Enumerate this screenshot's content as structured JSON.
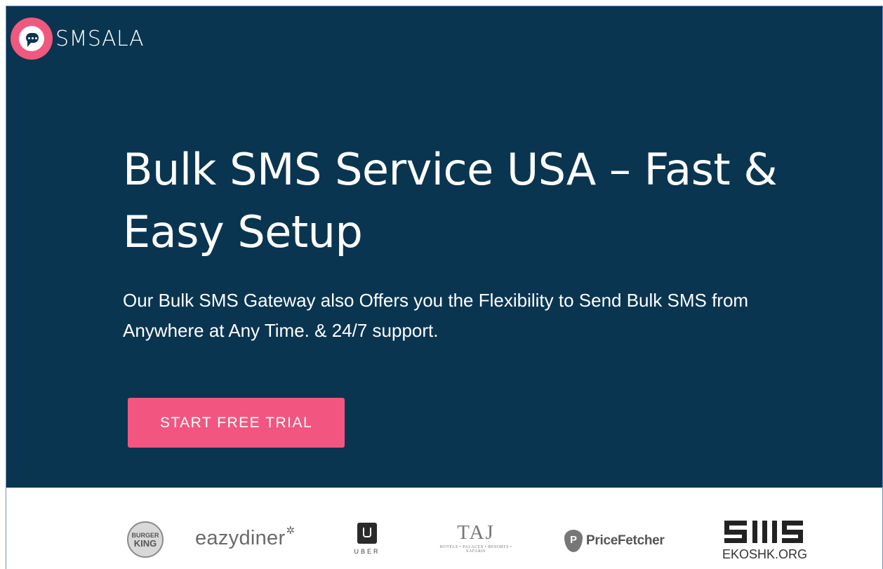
{
  "brand": {
    "name": "SMSALA",
    "logo_icon": "chat-bubble-icon",
    "accent": "#f25680"
  },
  "hero": {
    "background": "#0a3551",
    "headline": "Bulk SMS Service USA – Fast & Easy Setup",
    "subtitle": "Our Bulk SMS Gateway also Offers you the Flexibility to Send Bulk SMS from Anywhere at Any Time. & 24/7 support.",
    "cta_label": "START FREE TRIAL"
  },
  "clients": {
    "burger_king": {
      "line1": "BURGER",
      "line2": "KING"
    },
    "eazydiner": {
      "name": "eazydiner"
    },
    "uber": {
      "name": "UBER"
    },
    "taj": {
      "name": "TAJ",
      "tagline": "HOTELS • PALACES • RESORTS • SAFARIS"
    },
    "pricefetcher": {
      "name": "PriceFetcher"
    },
    "ekoshk": {
      "name": "EKOSHK.ORG"
    }
  }
}
